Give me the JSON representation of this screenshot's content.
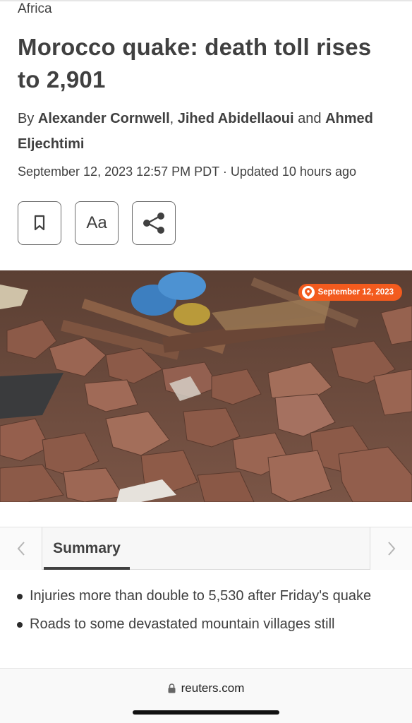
{
  "article": {
    "section": "Africa",
    "headline": "Morocco quake: death toll rises to 2,901",
    "byline_prefix": "By",
    "authors": [
      "Alexander Cornwell",
      "Jihed Abidellaoui",
      "Ahmed Eljechtimi"
    ],
    "byline_sep_1": ",",
    "byline_sep_2": "and",
    "dateline": "September 12, 2023 12:57 PM PDT · Updated 10 hours ago"
  },
  "tools": {
    "bookmark_icon": "bookmark-icon",
    "text_size_label": "Aa",
    "share_icon": "share-icon"
  },
  "media": {
    "date_badge": "September 12, 2023",
    "badge_icon": "location-pin-icon",
    "badge_color": "#f35b1e"
  },
  "summary": {
    "prev_icon": "chevron-left-icon",
    "tab_label": "Summary",
    "next_icon": "chevron-right-icon",
    "bullets": [
      "Injuries more than double to 5,530 after Friday's quake",
      "Roads to some devastated mountain villages still"
    ]
  },
  "browser": {
    "lock_icon": "lock-icon",
    "url": "reuters.com"
  }
}
